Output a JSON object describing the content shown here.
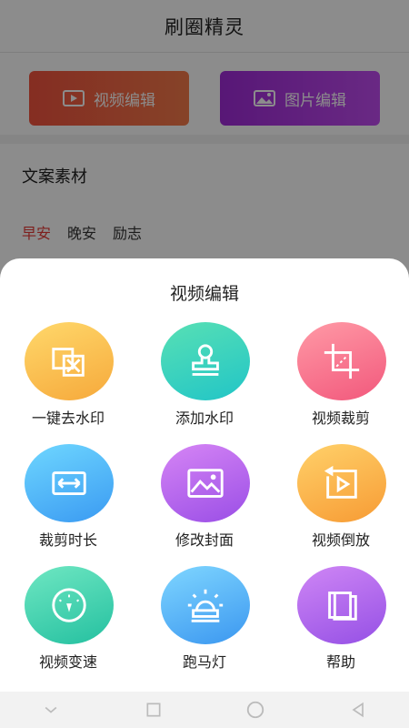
{
  "app": {
    "title": "刷圈精灵",
    "actions": [
      {
        "label": "视频编辑",
        "color": "#f3533f"
      },
      {
        "label": "图片编辑",
        "color": "#a02bd8"
      }
    ],
    "section_title": "文案素材",
    "tabs": [
      {
        "label": "早安",
        "active": true
      },
      {
        "label": "晚安",
        "active": false
      },
      {
        "label": "励志",
        "active": false
      }
    ]
  },
  "sheet": {
    "title": "视频编辑",
    "tools": [
      {
        "label": "一键去水印",
        "icon": "remove-watermark-icon",
        "colors": [
          "#ffd86b",
          "#f6a93b"
        ]
      },
      {
        "label": "添加水印",
        "icon": "stamp-icon",
        "colors": [
          "#58e0b4",
          "#21c5c7"
        ]
      },
      {
        "label": "视频裁剪",
        "icon": "crop-icon",
        "colors": [
          "#ff9aa6",
          "#f2587c"
        ]
      },
      {
        "label": "裁剪时长",
        "icon": "trim-duration-icon",
        "colors": [
          "#6fd7ff",
          "#3a9af2"
        ]
      },
      {
        "label": "修改封面",
        "icon": "image-cover-icon",
        "colors": [
          "#d685f5",
          "#9a4ee6"
        ]
      },
      {
        "label": "视频倒放",
        "icon": "reverse-play-icon",
        "colors": [
          "#ffd16a",
          "#f79b34"
        ]
      },
      {
        "label": "视频变速",
        "icon": "speedometer-icon",
        "colors": [
          "#6fe7c2",
          "#24c0a0"
        ]
      },
      {
        "label": "跑马灯",
        "icon": "marquee-light-icon",
        "colors": [
          "#7fd6ff",
          "#3b97f0"
        ]
      },
      {
        "label": "帮助",
        "icon": "help-book-icon",
        "colors": [
          "#cf86f5",
          "#9550e5"
        ]
      }
    ]
  },
  "navbar": {
    "buttons": [
      "back-icon",
      "recent-apps-icon",
      "home-icon",
      "triangle-back-icon"
    ]
  }
}
